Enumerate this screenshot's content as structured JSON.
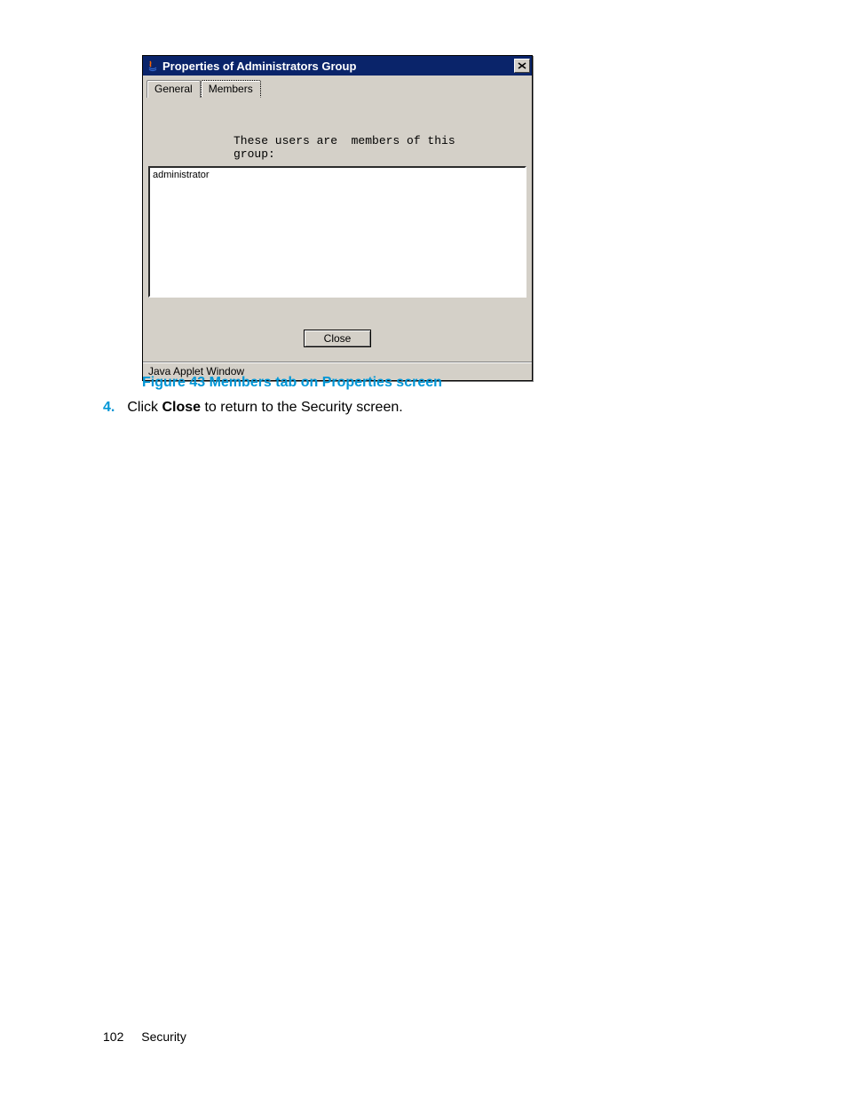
{
  "dialog": {
    "title": "Properties of Administrators Group",
    "tabs": {
      "general": "General",
      "members": "Members"
    },
    "group_label": "These users are  members of this\ngroup:",
    "list_items": [
      "administrator"
    ],
    "close_button": "Close",
    "status": "Java Applet Window"
  },
  "figure_caption": "Figure 43 Members tab on Properties screen",
  "step": {
    "number": "4.",
    "pre": "Click ",
    "bold": "Close",
    "post": " to return to the Security screen."
  },
  "footer": {
    "page": "102",
    "section": "Security"
  }
}
